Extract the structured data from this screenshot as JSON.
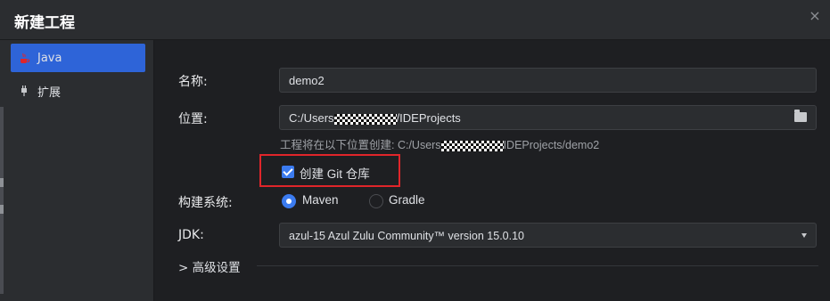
{
  "window": {
    "title": "新建工程",
    "close_symbol": "×"
  },
  "sidebar": {
    "items": [
      {
        "label": "Java",
        "icon": "java-icon",
        "active": true
      },
      {
        "label": "扩展",
        "icon": "plug-icon",
        "active": false
      }
    ]
  },
  "form": {
    "name": {
      "label": "名称:",
      "value": "demo2"
    },
    "location": {
      "label": "位置:",
      "value_prefix": "C:/Users",
      "value_suffix": "/IDEProjects",
      "browse_icon": "folder-icon"
    },
    "hint": {
      "prefix": "工程将在以下位置创建:  C:/Users",
      "suffix": "IDEProjects/demo2"
    },
    "git": {
      "label": "创建 Git 仓库",
      "checked": true
    },
    "build_system": {
      "label": "构建系统:",
      "options": [
        "Maven",
        "Gradle"
      ],
      "selected": "Maven"
    },
    "jdk": {
      "label": "JDK:",
      "value": "azul-15 Azul Zulu Community™ version 15.0.10"
    },
    "advanced": {
      "label": "高级设置",
      "chevron": ">"
    }
  },
  "colors": {
    "accent": "#2e64d8",
    "highlight_box": "#e0252a",
    "background": "#1e1f22"
  }
}
